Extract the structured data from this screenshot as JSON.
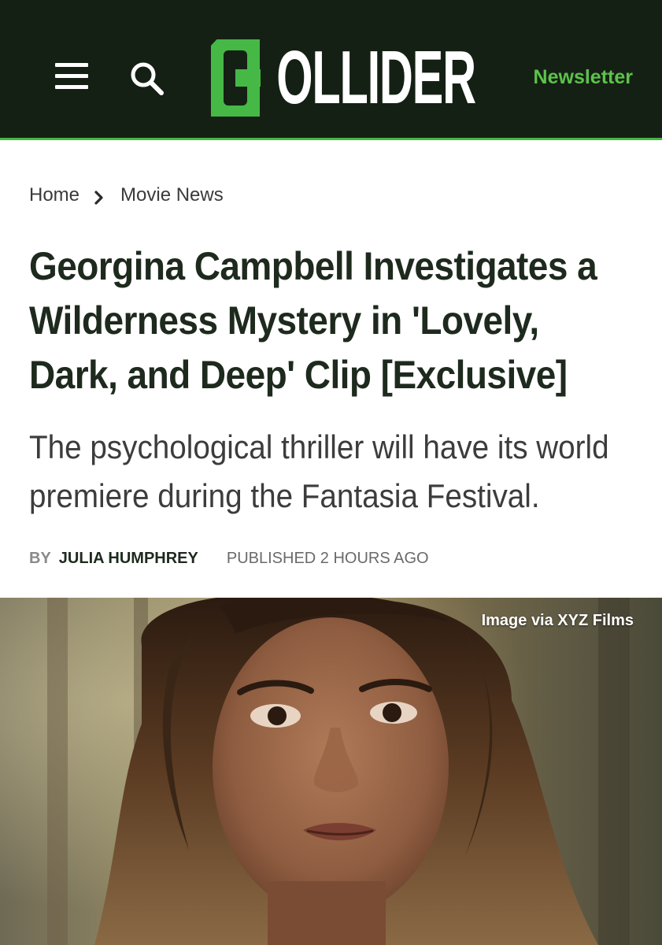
{
  "header": {
    "logo_text": "COLLIDER",
    "newsletter_label": "Newsletter",
    "brand_color": "#46b846",
    "background_color": "#152015"
  },
  "breadcrumb": {
    "items": [
      "Home",
      "Movie News"
    ]
  },
  "article": {
    "title": "Georgina Campbell Investigates a Wilderness Mystery in 'Lovely, Dark, and Deep' Clip [Exclusive]",
    "subtitle": "The psychological thriller will have its world premiere during the Fantasia Festival.",
    "byline_prefix": "BY",
    "author": "JULIA HUMPHREY",
    "published": "PUBLISHED 2 HOURS AGO"
  },
  "hero": {
    "credit": "Image via XYZ Films"
  },
  "icons": {
    "menu": "hamburger-menu-icon",
    "search": "search-icon",
    "breadcrumb_separator": "chevron-right-icon"
  }
}
